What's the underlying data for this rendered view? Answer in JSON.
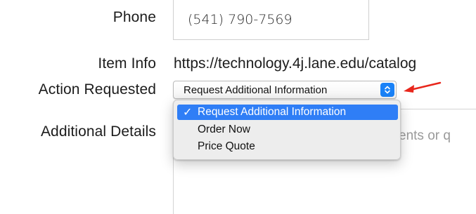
{
  "form": {
    "phone_label": "Phone",
    "phone_value": "(541) 790-7569",
    "item_info_label": "Item Info",
    "item_info_value": "https://technology.4j.lane.edu/catalog",
    "action_label": "Action Requested",
    "action_selected": "Request Additional Information",
    "details_label": "Additional Details",
    "details_placeholder_fragment": "ents or q"
  },
  "dropdown": {
    "options": [
      {
        "label": "Request Additional Information",
        "checked": true
      },
      {
        "label": "Order Now",
        "checked": false
      },
      {
        "label": "Price Quote",
        "checked": false
      }
    ],
    "check_glyph": "✓"
  },
  "colors": {
    "highlight": "#2f7ef6",
    "stepper": "#1a82f7",
    "arrow": "#e8261b"
  }
}
